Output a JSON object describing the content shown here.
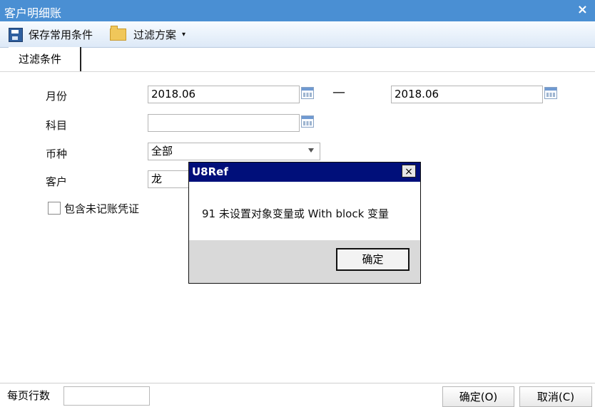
{
  "window": {
    "title": "客户明细账",
    "close_glyph": "×"
  },
  "toolbar": {
    "save_label": "保存常用条件",
    "filter_label": "过滤方案",
    "filter_caret": "▾"
  },
  "tabs": [
    {
      "label": "过滤条件"
    }
  ],
  "form": {
    "month": {
      "label": "月份",
      "from": "2018.06",
      "to": "2018.06",
      "separator": "—"
    },
    "subject": {
      "label": "科目",
      "value": ""
    },
    "currency": {
      "label": "币种",
      "value": "全部"
    },
    "customer": {
      "label": "客户",
      "value": "龙"
    },
    "include_unposted": {
      "label": "包含未记账凭证",
      "checked": false
    }
  },
  "dialog": {
    "title": "U8Ref",
    "message": "91 未设置对象变量或 With block 变量",
    "ok_label": "确定",
    "close_glyph": "×"
  },
  "bottom": {
    "rows_label": "每页行数",
    "rows_value": "",
    "ok_label": "确定(O)",
    "cancel_label": "取消(C)"
  },
  "colors": {
    "title_bar": "#4a8fd3",
    "dialog_title": "#000f7a"
  },
  "icons": {
    "toolbar_save": "save-icon",
    "toolbar_filter": "folder-icon",
    "calendar": "calendar-icon"
  }
}
